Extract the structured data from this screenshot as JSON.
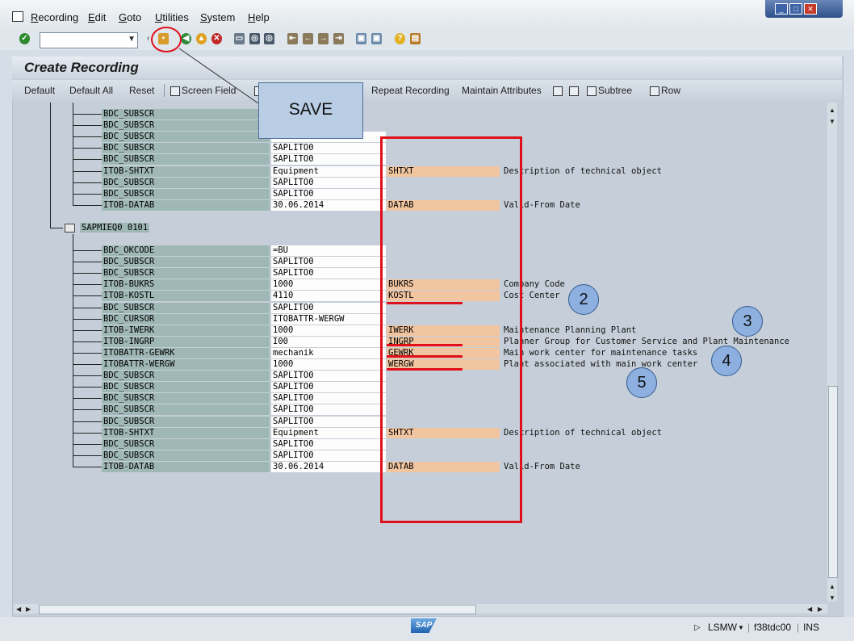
{
  "menu": {
    "items": [
      "Recording",
      "Edit",
      "Goto",
      "Utilities",
      "System",
      "Help"
    ]
  },
  "window_controls": [
    "_",
    "□",
    "✕"
  ],
  "toolbar": {
    "command_field_value": "",
    "dropdown_glyph": "▼"
  },
  "screen": {
    "title": "Create Recording"
  },
  "app_toolbar": {
    "default": "Default",
    "default_all": "Default All",
    "reset": "Reset",
    "screen_field": "Screen Field",
    "repeat_recording": "Repeat Recording",
    "maintain_attributes": "Maintain Attributes",
    "subtree": "Subtree",
    "row": "Row"
  },
  "tree": {
    "node_label": "SAPMIEQ0 0101",
    "group1": [
      {
        "name": "BDC_SUBSCR",
        "value": "",
        "tech": "",
        "desc": ""
      },
      {
        "name": "BDC_SUBSCR",
        "value": "",
        "tech": "",
        "desc": ""
      },
      {
        "name": "BDC_SUBSCR",
        "value": "SAPLITO0",
        "tech": "",
        "desc": ""
      },
      {
        "name": "BDC_SUBSCR",
        "value": "SAPLITO0",
        "tech": "",
        "desc": ""
      },
      {
        "name": "BDC_SUBSCR",
        "value": "SAPLITO0",
        "tech": "",
        "desc": ""
      },
      {
        "name": "ITOB-SHTXT",
        "value": "Equipment",
        "tech": "SHTXT",
        "desc": "Description of technical object"
      },
      {
        "name": "BDC_SUBSCR",
        "value": "SAPLITO0",
        "tech": "",
        "desc": ""
      },
      {
        "name": "BDC_SUBSCR",
        "value": "SAPLITO0",
        "tech": "",
        "desc": ""
      },
      {
        "name": "ITOB-DATAB",
        "value": "30.06.2014",
        "tech": "DATAB",
        "desc": "Valid-From Date"
      }
    ],
    "group2": [
      {
        "name": "BDC_OKCODE",
        "value": "=BU",
        "tech": "",
        "desc": ""
      },
      {
        "name": "BDC_SUBSCR",
        "value": "SAPLITO0",
        "tech": "",
        "desc": ""
      },
      {
        "name": "BDC_SUBSCR",
        "value": "SAPLITO0",
        "tech": "",
        "desc": ""
      },
      {
        "name": "ITOB-BUKRS",
        "value": "1000",
        "tech": "BUKRS",
        "desc": "Company Code"
      },
      {
        "name": "ITOB-KOSTL",
        "value": "4110",
        "tech": "KOSTL",
        "desc": "Cost Center"
      },
      {
        "name": "BDC_SUBSCR",
        "value": "SAPLITO0",
        "tech": "",
        "desc": ""
      },
      {
        "name": "BDC_CURSOR",
        "value": "ITOBATTR-WERGW",
        "tech": "",
        "desc": ""
      },
      {
        "name": "ITOB-IWERK",
        "value": "1000",
        "tech": "IWERK",
        "desc": "Maintenance Planning Plant"
      },
      {
        "name": "ITOB-INGRP",
        "value": "I00",
        "tech": "INGRP",
        "desc": "Planner Group for Customer Service and Plant Maintenance"
      },
      {
        "name": "ITOBATTR-GEWRK",
        "value": "mechanik",
        "tech": "GEWRK",
        "desc": "Main work center for maintenance tasks"
      },
      {
        "name": "ITOBATTR-WERGW",
        "value": "1000",
        "tech": "WERGW",
        "desc": "Plant associated with main work center"
      },
      {
        "name": "BDC_SUBSCR",
        "value": "SAPLITO0",
        "tech": "",
        "desc": ""
      },
      {
        "name": "BDC_SUBSCR",
        "value": "SAPLITO0",
        "tech": "",
        "desc": ""
      },
      {
        "name": "BDC_SUBSCR",
        "value": "SAPLITO0",
        "tech": "",
        "desc": ""
      },
      {
        "name": "BDC_SUBSCR",
        "value": "SAPLITO0",
        "tech": "",
        "desc": ""
      },
      {
        "name": "BDC_SUBSCR",
        "value": "SAPLITO0",
        "tech": "",
        "desc": ""
      },
      {
        "name": "ITOB-SHTXT",
        "value": "Equipment",
        "tech": "SHTXT",
        "desc": "Description of technical object"
      },
      {
        "name": "BDC_SUBSCR",
        "value": "SAPLITO0",
        "tech": "",
        "desc": ""
      },
      {
        "name": "BDC_SUBSCR",
        "value": "SAPLITO0",
        "tech": "",
        "desc": ""
      },
      {
        "name": "ITOB-DATAB",
        "value": "30.06.2014",
        "tech": "DATAB",
        "desc": "Valid-From Date"
      }
    ]
  },
  "annotations": {
    "save_label": "SAVE",
    "badges": [
      "2",
      "3",
      "4",
      "5"
    ],
    "accent_color": "#e0101a"
  },
  "statusbar": {
    "sap_logo": "SAP",
    "transaction": "LSMW",
    "server": "f38tdc00",
    "mode": "INS"
  },
  "colors": {
    "field_name_bg": "#9fb8b5",
    "tech_name_bg": "#f1c5a0",
    "screen_bg": "#c6cfd9"
  }
}
